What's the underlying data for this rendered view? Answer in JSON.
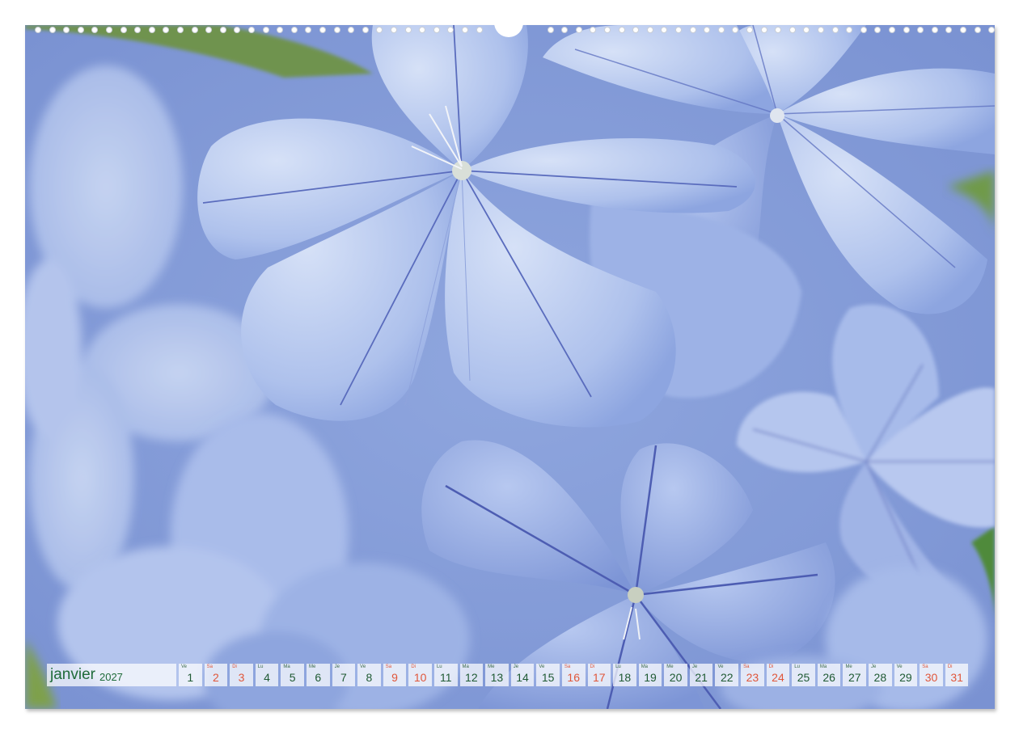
{
  "calendar": {
    "month": "janvier",
    "year": "2027",
    "days": [
      {
        "d": "1",
        "w": "Ve",
        "weekend": false
      },
      {
        "d": "2",
        "w": "Sa",
        "weekend": true
      },
      {
        "d": "3",
        "w": "Di",
        "weekend": true
      },
      {
        "d": "4",
        "w": "Lu",
        "weekend": false
      },
      {
        "d": "5",
        "w": "Ma",
        "weekend": false
      },
      {
        "d": "6",
        "w": "Me",
        "weekend": false
      },
      {
        "d": "7",
        "w": "Je",
        "weekend": false
      },
      {
        "d": "8",
        "w": "Ve",
        "weekend": false
      },
      {
        "d": "9",
        "w": "Sa",
        "weekend": true
      },
      {
        "d": "10",
        "w": "Di",
        "weekend": true
      },
      {
        "d": "11",
        "w": "Lu",
        "weekend": false
      },
      {
        "d": "12",
        "w": "Ma",
        "weekend": false
      },
      {
        "d": "13",
        "w": "Me",
        "weekend": false
      },
      {
        "d": "14",
        "w": "Je",
        "weekend": false
      },
      {
        "d": "15",
        "w": "Ve",
        "weekend": false
      },
      {
        "d": "16",
        "w": "Sa",
        "weekend": true
      },
      {
        "d": "17",
        "w": "Di",
        "weekend": true
      },
      {
        "d": "18",
        "w": "Lu",
        "weekend": false
      },
      {
        "d": "19",
        "w": "Ma",
        "weekend": false
      },
      {
        "d": "20",
        "w": "Me",
        "weekend": false
      },
      {
        "d": "21",
        "w": "Je",
        "weekend": false
      },
      {
        "d": "22",
        "w": "Ve",
        "weekend": false
      },
      {
        "d": "23",
        "w": "Sa",
        "weekend": true
      },
      {
        "d": "24",
        "w": "Di",
        "weekend": true
      },
      {
        "d": "25",
        "w": "Lu",
        "weekend": false
      },
      {
        "d": "26",
        "w": "Ma",
        "weekend": false
      },
      {
        "d": "27",
        "w": "Me",
        "weekend": false
      },
      {
        "d": "28",
        "w": "Je",
        "weekend": false
      },
      {
        "d": "29",
        "w": "Ve",
        "weekend": false
      },
      {
        "d": "30",
        "w": "Sa",
        "weekend": true
      },
      {
        "d": "31",
        "w": "Di",
        "weekend": true
      }
    ]
  },
  "colors": {
    "petal_light": "#c3d2f2",
    "petal_mid": "#9cb3e6",
    "petal_dark": "#6f86cf",
    "vein": "#5566b8",
    "leaf": "#7fa04a",
    "month_text": "#1f6b3a",
    "weekend_text": "#e0563a"
  }
}
